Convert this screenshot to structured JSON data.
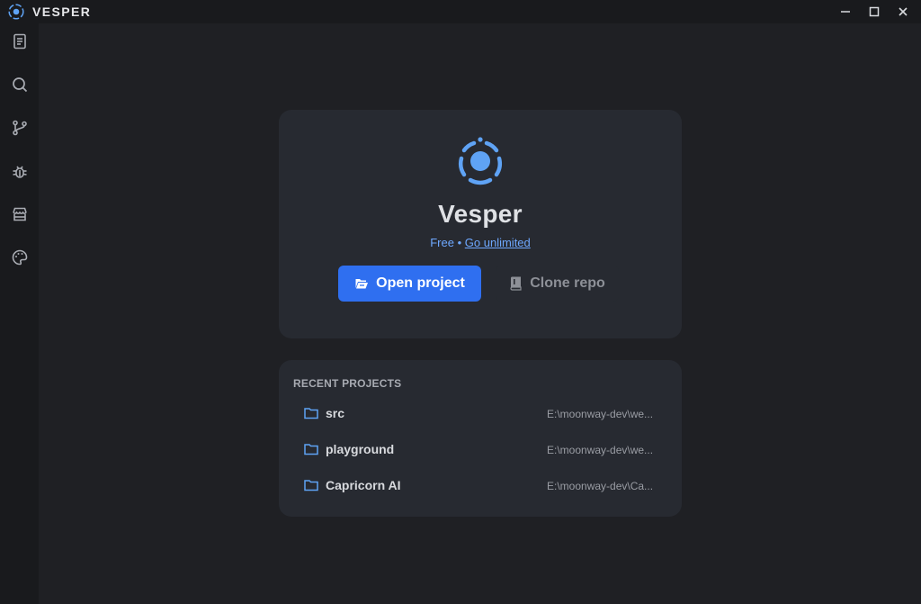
{
  "window": {
    "title": "VESPER",
    "controls": [
      "minimize-icon",
      "maximize-icon",
      "close-icon"
    ]
  },
  "sidebar": {
    "items": [
      {
        "icon": "explorer-icon"
      },
      {
        "icon": "search-icon"
      },
      {
        "icon": "source-control-icon"
      },
      {
        "icon": "debug-icon"
      },
      {
        "icon": "marketplace-icon"
      },
      {
        "icon": "theme-palette-icon"
      }
    ]
  },
  "welcome": {
    "app_name": "Vesper",
    "plan": "Free",
    "separator": "•",
    "upgrade_link": "Go unlimited",
    "open_project_label": "Open project",
    "clone_repo_label": "Clone repo"
  },
  "recent": {
    "heading": "RECENT PROJECTS",
    "projects": [
      {
        "name": "src",
        "path": "E:\\moonway-dev\\we..."
      },
      {
        "name": "playground",
        "path": "E:\\moonway-dev\\we..."
      },
      {
        "name": "Capricorn AI",
        "path": "E:\\moonway-dev\\Ca..."
      }
    ]
  },
  "colors": {
    "accent": "#2f6ff0",
    "link": "#6ea8ff",
    "logo": "#5fa3f5",
    "background": "#1f2024",
    "card": "#272a31"
  }
}
